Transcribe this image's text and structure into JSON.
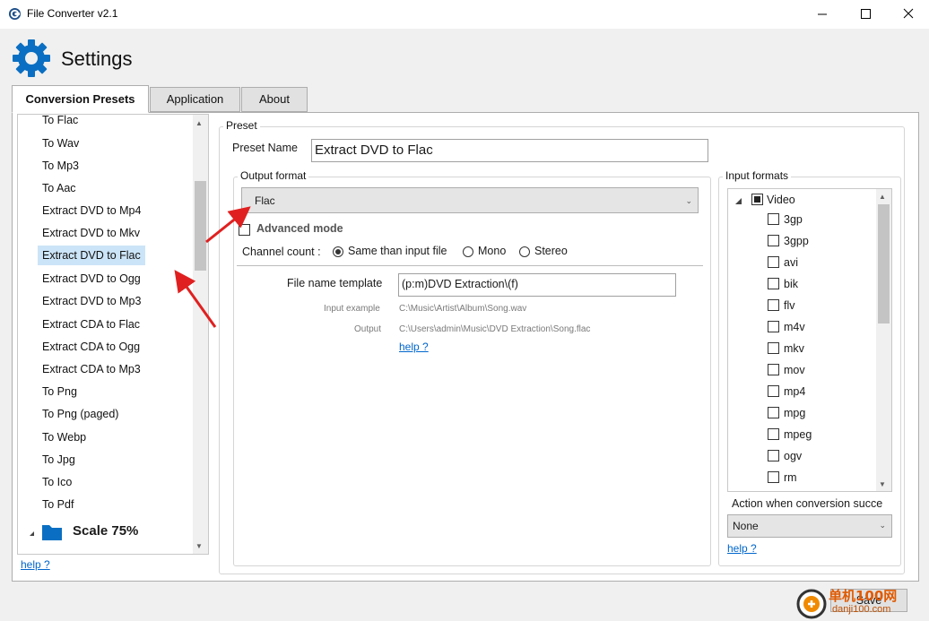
{
  "window": {
    "title": "File Converter v2.1"
  },
  "header": {
    "title": "Settings"
  },
  "tabs": [
    {
      "label": "Conversion Presets",
      "active": true
    },
    {
      "label": "Application",
      "active": false
    },
    {
      "label": "About",
      "active": false
    }
  ],
  "preset_list": {
    "items": [
      "To Flac",
      "To Wav",
      "To Mp3",
      "To Aac",
      "Extract DVD to Mp4",
      "Extract DVD to Mkv",
      "Extract DVD to Flac",
      "Extract DVD to Ogg",
      "Extract DVD to Mp3",
      "Extract CDA to Flac",
      "Extract CDA to Ogg",
      "Extract CDA to Mp3",
      "To Png",
      "To Png (paged)",
      "To Webp",
      "To Jpg",
      "To Ico",
      "To Pdf"
    ],
    "selected": "Extract DVD to Flac",
    "folder_label": "Scale 75%",
    "help_label": "help ?"
  },
  "preset": {
    "group_label": "Preset",
    "name_label": "Preset Name",
    "name_value": "Extract DVD to Flac",
    "output_group_label": "Output format",
    "output_format": "Flac",
    "advanced_mode_label": "Advanced mode",
    "channel_label": "Channel count :",
    "channel_options": [
      "Same than input file",
      "Mono",
      "Stereo"
    ],
    "channel_selected": "Same than input file",
    "template_label": "File name template",
    "template_value": "(p:m)DVD Extraction\\(f)",
    "input_example_label": "Input example",
    "input_example_value": "C:\\Music\\Artist\\Album\\Song.wav",
    "output_label": "Output",
    "output_value": "C:\\Users\\admin\\Music\\DVD Extraction\\Song.flac",
    "help_label": "help ?"
  },
  "input_formats": {
    "group_label": "Input formats",
    "category": "Video",
    "items": [
      "3gp",
      "3gpp",
      "avi",
      "bik",
      "flv",
      "m4v",
      "mkv",
      "mov",
      "mp4",
      "mpg",
      "mpeg",
      "ogv",
      "rm"
    ],
    "action_label": "Action when conversion succe",
    "action_value": "None",
    "help_label": "help ?"
  },
  "footer": {
    "save_label": "Save"
  },
  "watermark": {
    "text": "单机100网",
    "url": "danji100.com"
  },
  "colors": {
    "accent": "#0078d4",
    "selection": "#cce4f7",
    "link": "#0066cc",
    "annotation_arrow": "#e02020"
  }
}
